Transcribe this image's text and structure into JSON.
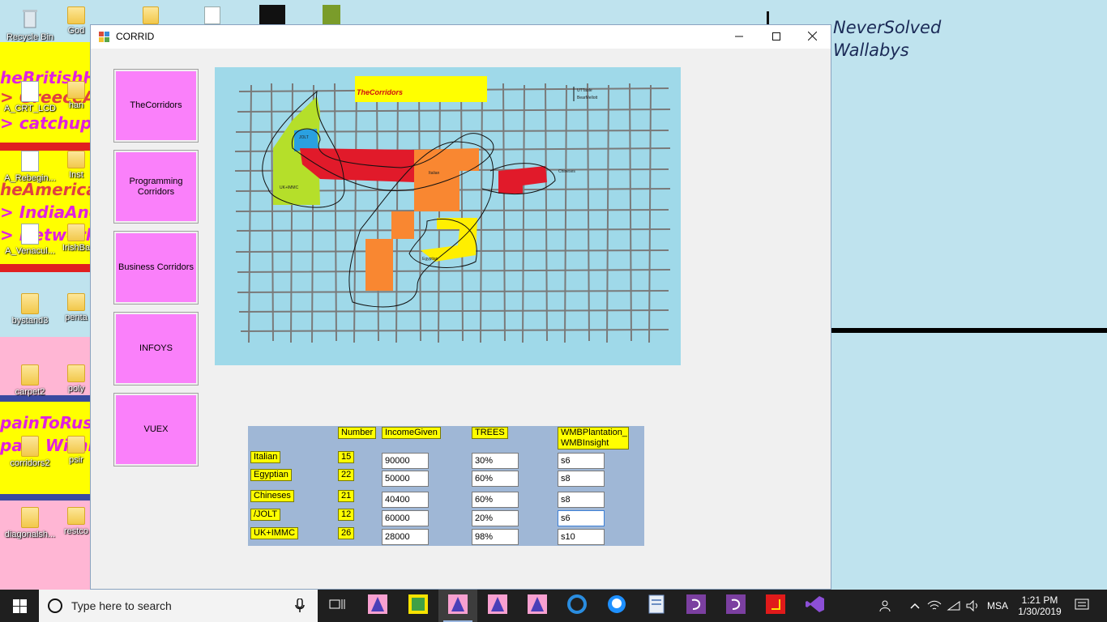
{
  "desktop": {
    "icons": [
      {
        "label": "Recycle Bin"
      },
      {
        "label": "God"
      },
      {
        "label": "A_CRT_LCD"
      },
      {
        "label": "han"
      },
      {
        "label": "A_Rebegin..."
      },
      {
        "label": "Inst"
      },
      {
        "label": "A_Venacul..."
      },
      {
        "label": "IrishBa"
      },
      {
        "label": "bystand3"
      },
      {
        "label": "penta"
      },
      {
        "label": "carpet2"
      },
      {
        "label": "poly"
      },
      {
        "label": "corridors2"
      },
      {
        "label": "psir"
      },
      {
        "label": "diagonalsh..."
      },
      {
        "label": "restco"
      }
    ],
    "background_texts": [
      "heBritishHo",
      "> GreeceAr",
      "> catchupW",
      "heAmerican",
      "> IndiaAndF",
      "> Network",
      "painToRussi",
      "pain WithPo"
    ],
    "background_note": {
      "line1": "NeverSolved",
      "line2": "Wallabys"
    }
  },
  "window": {
    "title": "CORRID",
    "sidebar_buttons": [
      "TheCorridors",
      "Programming Corridors",
      "Business Corridors",
      "INFOYS",
      "VUEX"
    ],
    "map": {
      "title": "TheCorridors",
      "legend_line1": "UTTable",
      "legend_line2": "BearMellott",
      "labels": {
        "uk": "UK+IMMC",
        "jolt": "JOLT",
        "italian": "Italian",
        "chineses": "Chineses",
        "egyptian": "Egyptian"
      }
    },
    "table": {
      "headers": {
        "number": "Number",
        "income": "IncomeGiven",
        "trees": "TREES",
        "wmb": "WMBPlantation_ WMBInsight"
      },
      "rows": [
        {
          "name": "Italian",
          "number": "15",
          "income": "90000",
          "trees": "30%",
          "wmb": "s6"
        },
        {
          "name": "Egyptian",
          "number": "22",
          "income": "50000",
          "trees": "60%",
          "wmb": "s8"
        },
        {
          "name": "Chineses",
          "number": "21",
          "income": "40400",
          "trees": "60%",
          "wmb": "s8"
        },
        {
          "name": "/JOLT",
          "number": "12",
          "income": "60000",
          "trees": "20%",
          "wmb": "s6"
        },
        {
          "name": "UK+IMMC",
          "number": "26",
          "income": "28000",
          "trees": "98%",
          "wmb": "s10"
        }
      ]
    }
  },
  "taskbar": {
    "search_placeholder": "Type here to search",
    "language": "MSA",
    "time": "1:21 PM",
    "date": "1/30/2019"
  },
  "colors": {
    "sidebar_button": "#fa80fa",
    "label_yellow": "#ffff00",
    "map_background": "#9fd9e9",
    "table_background": "#9fb7d6"
  }
}
